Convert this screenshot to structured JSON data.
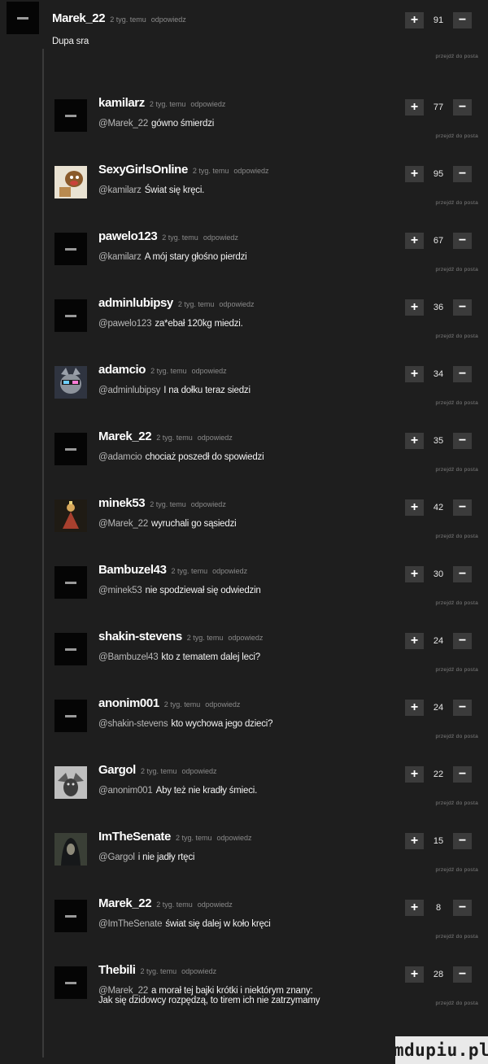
{
  "labels": {
    "time": "2 tyg. temu",
    "reply": "odpowiedz",
    "goto_post": "przejdź do posta",
    "plus": "+",
    "minus": "−"
  },
  "watermark": "mdupiu.pl",
  "comments": [
    {
      "user": "Marek_22",
      "mention": "",
      "text": "Dupa sra",
      "votes": "91",
      "avatar": "default"
    },
    {
      "user": "kamilarz",
      "mention": "@Marek_22",
      "text": "gówno śmierdzi",
      "votes": "77",
      "avatar": "default"
    },
    {
      "user": "SexyGirlsOnline",
      "mention": "@kamilarz",
      "text": "Świat się kręci.",
      "votes": "95",
      "avatar": "cartoon-icon"
    },
    {
      "user": "pawelo123",
      "mention": "@kamilarz",
      "text": "A mój stary głośno pierdzi",
      "votes": "67",
      "avatar": "default"
    },
    {
      "user": "adminlubipsy",
      "mention": "@pawelo123",
      "text": "za*ebał 120kg miedzi.",
      "votes": "36",
      "avatar": "default"
    },
    {
      "user": "adamcio",
      "mention": "@adminlubipsy",
      "text": "I na dołku teraz siedzi",
      "votes": "34",
      "avatar": "cat-icon"
    },
    {
      "user": "Marek_22",
      "mention": "@adamcio",
      "text": "chociaż poszedł do spowiedzi",
      "votes": "35",
      "avatar": "default"
    },
    {
      "user": "minek53",
      "mention": "@Marek_22",
      "text": "wyruchali go sąsiedzi",
      "votes": "42",
      "avatar": "figure-icon"
    },
    {
      "user": "Bambuzel43",
      "mention": "@minek53",
      "text": "nie spodziewał się odwiedzin",
      "votes": "30",
      "avatar": "default"
    },
    {
      "user": "shakin-stevens",
      "mention": "@Bambuzel43",
      "text": "kto z tematem dalej leci?",
      "votes": "24",
      "avatar": "default"
    },
    {
      "user": "anonim001",
      "mention": "@shakin-stevens",
      "text": "kto wychowa jego dzieci?",
      "votes": "24",
      "avatar": "default"
    },
    {
      "user": "Gargol",
      "mention": "@anonim001",
      "text": "Aby też nie kradły śmieci.",
      "votes": "22",
      "avatar": "gargoyle-icon"
    },
    {
      "user": "ImTheSenate",
      "mention": "@Gargol",
      "text": "i nie jadły rtęci",
      "votes": "15",
      "avatar": "hooded-figure-icon"
    },
    {
      "user": "Marek_22",
      "mention": "@ImTheSenate",
      "text": "świat się dalej w koło kręci",
      "votes": "8",
      "avatar": "default"
    },
    {
      "user": "Thebili",
      "mention": "@Marek_22",
      "text": "a morał tej bajki krótki i niektórym znany:",
      "text2": "Jak się dzidowcy rozpędzą, to tirem ich nie zatrzymamy",
      "votes": "28",
      "avatar": "default"
    }
  ]
}
